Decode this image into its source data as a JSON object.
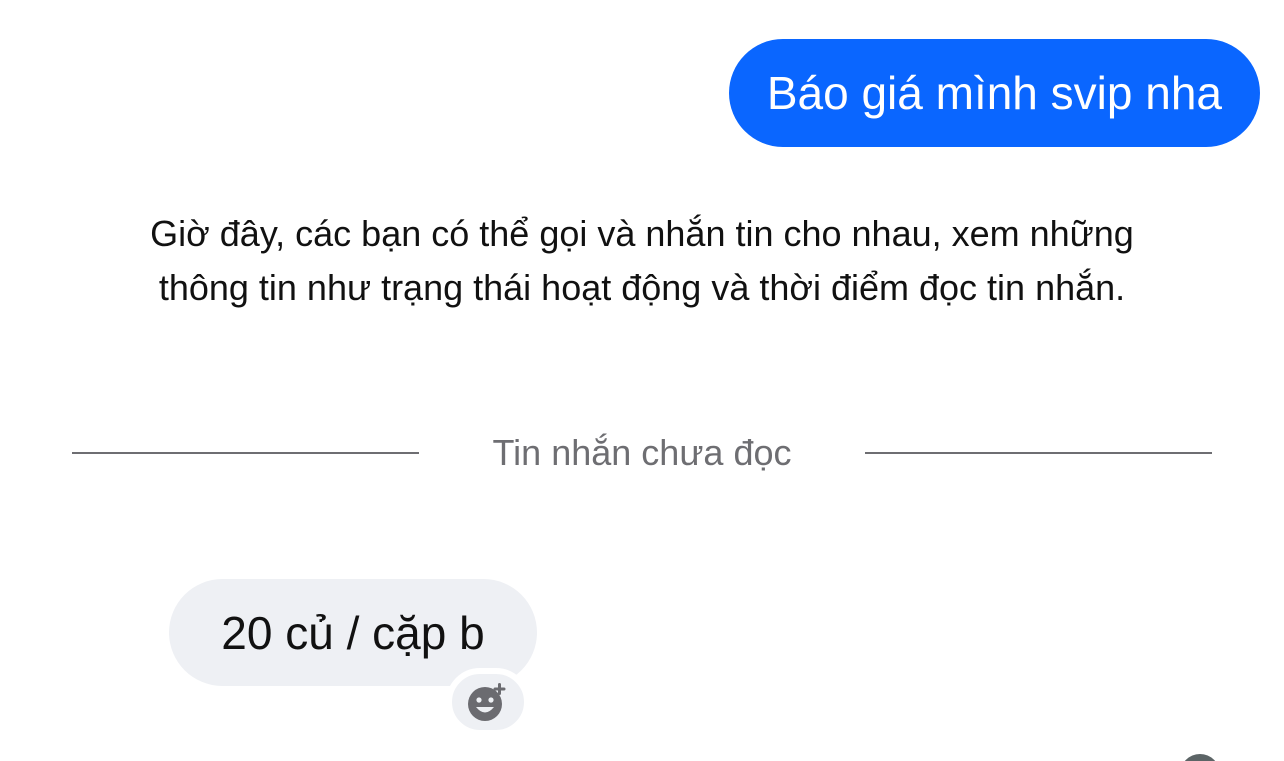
{
  "messages": {
    "outgoing": {
      "text": "Báo giá mình svip nha"
    },
    "incoming": {
      "text": "20 củ / cặp b"
    }
  },
  "system_notice": {
    "line1": "Giờ đây, các bạn có thể gọi và nhắn tin cho nhau, xem những",
    "line2": "thông tin như trạng thái hoạt động và thời điểm đọc tin nhắn."
  },
  "unread_divider": {
    "label": "Tin nhắn chưa đọc"
  },
  "reaction_button": {
    "icon": "add-reaction-icon"
  },
  "colors": {
    "outgoing_bubble": "#0a66ff",
    "incoming_bubble": "#eef0f4",
    "divider": "#6e6e72",
    "text": "#111111"
  }
}
